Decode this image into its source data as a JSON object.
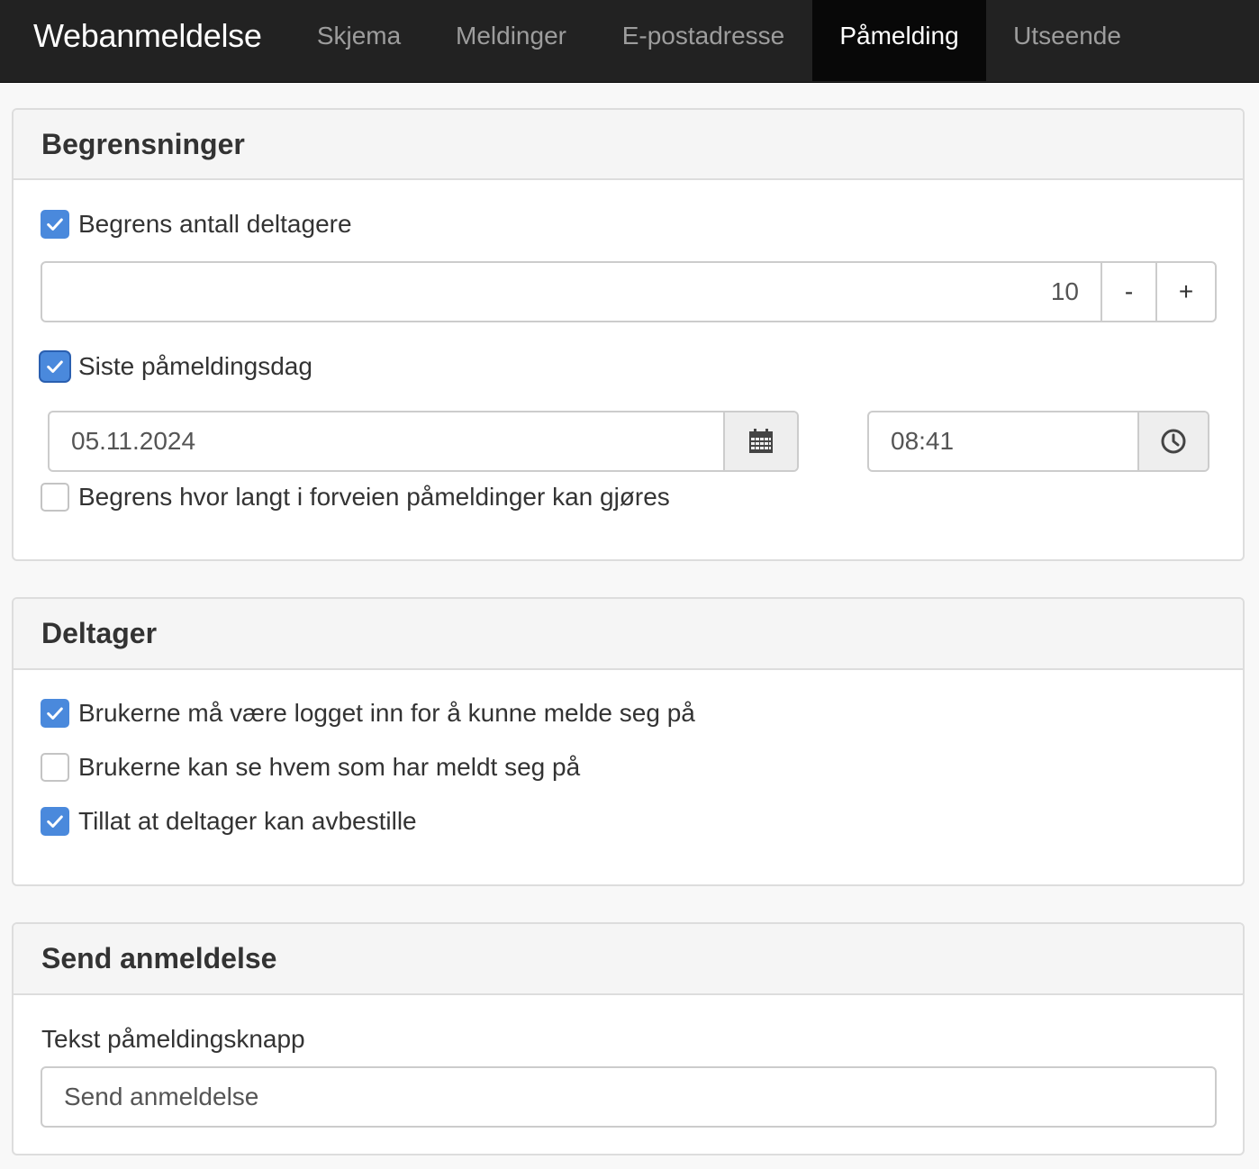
{
  "navbar": {
    "brand": "Webanmeldelse",
    "tabs": [
      {
        "label": "Skjema",
        "active": false
      },
      {
        "label": "Meldinger",
        "active": false
      },
      {
        "label": "E-postadresse",
        "active": false
      },
      {
        "label": "Påmelding",
        "active": true
      },
      {
        "label": "Utseende",
        "active": false
      }
    ]
  },
  "limits": {
    "title": "Begrensninger",
    "limit_participants": {
      "label": "Begrens antall deltagere",
      "checked": true
    },
    "participant_count": {
      "value": "10",
      "decrement_label": "-",
      "increment_label": "+"
    },
    "deadline": {
      "label": "Siste påmeldingsdag",
      "checked": true
    },
    "deadline_date": {
      "value": "05.11.2024",
      "icon": "calendar-icon"
    },
    "deadline_time": {
      "value": "08:41",
      "icon": "clock-icon"
    },
    "limit_advance": {
      "label": "Begrens hvor langt i forveien påmeldinger kan gjøres",
      "checked": false
    }
  },
  "participant": {
    "title": "Deltager",
    "options": [
      {
        "label": "Brukerne må være logget inn for å kunne melde seg på",
        "checked": true
      },
      {
        "label": "Brukerne kan se hvem som har meldt seg på",
        "checked": false
      },
      {
        "label": "Tillat at deltager kan avbestille",
        "checked": true
      }
    ]
  },
  "send": {
    "title": "Send anmeldelse",
    "button_text_label": "Tekst påmeldingsknapp",
    "button_text_value": "Send anmeldelse"
  },
  "colors": {
    "navbar_bg": "#222222",
    "nav_active_bg": "#080808",
    "checkbox_accent": "#4a89dc",
    "panel_heading_bg": "#f5f5f5"
  }
}
